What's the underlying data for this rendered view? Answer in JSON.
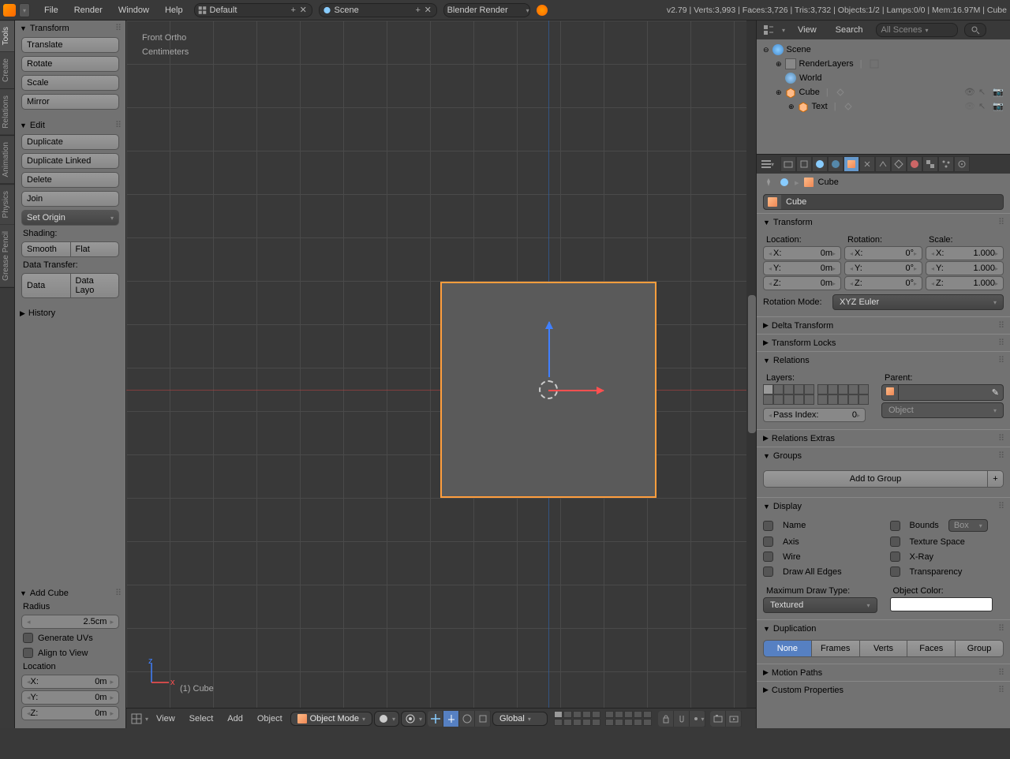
{
  "top_menu": {
    "items": [
      "File",
      "Render",
      "Window",
      "Help"
    ],
    "layout_field": "Default",
    "scene_field": "Scene",
    "engine": "Blender Render",
    "version_info": "v2.79 | Verts:3,993 | Faces:3,726 | Tris:3,732 | Objects:1/2 | Lamps:0/0 | Mem:16.97M | Cube"
  },
  "left_tabs": [
    "Tools",
    "Create",
    "Relations",
    "Animation",
    "Physics",
    "Grease Pencil"
  ],
  "tools_panel": {
    "transform_header": "Transform",
    "translate": "Translate",
    "rotate": "Rotate",
    "scale": "Scale",
    "mirror": "Mirror",
    "edit_header": "Edit",
    "duplicate": "Duplicate",
    "duplicate_linked": "Duplicate Linked",
    "delete": "Delete",
    "join": "Join",
    "set_origin": "Set Origin",
    "shading_label": "Shading:",
    "smooth": "Smooth",
    "flat": "Flat",
    "data_transfer_label": "Data Transfer:",
    "data": "Data",
    "data_layout": "Data Layo",
    "history_header": "History"
  },
  "add_cube_panel": {
    "header": "Add Cube",
    "radius_label": "Radius",
    "radius_value": "2.5cm",
    "generate_uvs": "Generate UVs",
    "align_to_view": "Align to View",
    "location_label": "Location",
    "x": {
      "label": "X:",
      "value": "0m"
    },
    "y": {
      "label": "Y:",
      "value": "0m"
    },
    "z": {
      "label": "Z:",
      "value": "0m"
    }
  },
  "viewport": {
    "view_name": "Front Ortho",
    "units": "Centimeters",
    "object_label": "(1) Cube"
  },
  "viewport_header": {
    "menus": [
      "View",
      "Select",
      "Add",
      "Object"
    ],
    "mode": "Object Mode",
    "orientation": "Global"
  },
  "outliner": {
    "view_menu": "View",
    "search_menu": "Search",
    "filter": "All Scenes",
    "scene": "Scene",
    "render_layers": "RenderLayers",
    "world": "World",
    "cube": "Cube",
    "text": "Text"
  },
  "properties": {
    "breadcrumb_obj": "Cube",
    "name_field": "Cube",
    "transform_header": "Transform",
    "location_label": "Location:",
    "rotation_label": "Rotation:",
    "scale_label": "Scale:",
    "loc": {
      "x": "0m",
      "y": "0m",
      "z": "0m"
    },
    "rot": {
      "x": "0°",
      "y": "0°",
      "z": "0°"
    },
    "scale": {
      "x": "1.000",
      "y": "1.000",
      "z": "1.000"
    },
    "rotation_mode_label": "Rotation Mode:",
    "rotation_mode": "XYZ Euler",
    "delta_transform": "Delta Transform",
    "transform_locks": "Transform Locks",
    "relations_header": "Relations",
    "layers_label": "Layers:",
    "parent_label": "Parent:",
    "parent_type": "Object",
    "pass_index_label": "Pass Index:",
    "pass_index_value": "0",
    "relations_extras": "Relations Extras",
    "groups_header": "Groups",
    "add_to_group": "Add to Group",
    "display_header": "Display",
    "disp_name": "Name",
    "disp_axis": "Axis",
    "disp_wire": "Wire",
    "disp_draw_all": "Draw All Edges",
    "disp_bounds": "Bounds",
    "disp_bounds_type": "Box",
    "disp_texture_space": "Texture Space",
    "disp_xray": "X-Ray",
    "disp_transparency": "Transparency",
    "max_draw_label": "Maximum Draw Type:",
    "max_draw_type": "Textured",
    "object_color_label": "Object Color:",
    "duplication_header": "Duplication",
    "dup_none": "None",
    "dup_frames": "Frames",
    "dup_verts": "Verts",
    "dup_faces": "Faces",
    "dup_group": "Group",
    "motion_paths": "Motion Paths",
    "custom_props": "Custom Properties"
  }
}
